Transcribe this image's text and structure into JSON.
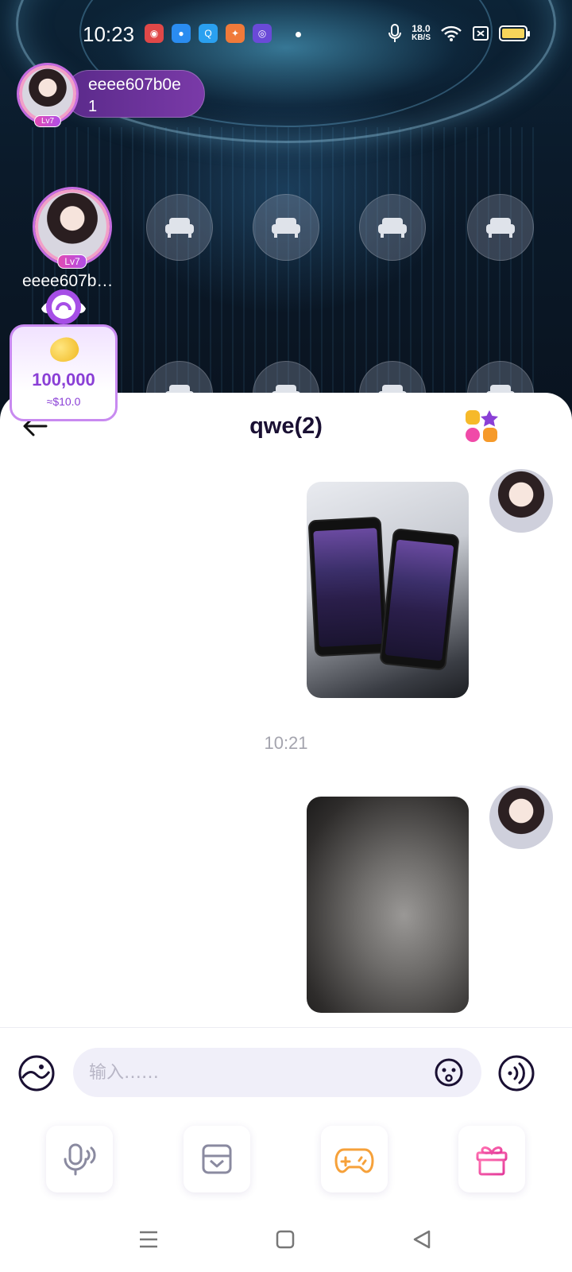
{
  "status_bar": {
    "time": "10:23",
    "speed_value": "18.0",
    "speed_unit": "KB/S",
    "app_icons": [
      "baidu-app-icon",
      "media-app-icon",
      "browser-app-icon",
      "game-app-icon",
      "vpn-app-icon"
    ]
  },
  "room": {
    "host": {
      "name": "eeee607b0e",
      "count": "1",
      "level": "Lv7"
    },
    "seat_user": {
      "name": "eeee607b…",
      "level": "Lv7"
    },
    "coins": {
      "value": "100,000",
      "usd": "≈$10.0"
    }
  },
  "chat": {
    "title": "qwe(2)",
    "timestamp": "10:21",
    "input_placeholder": "输入……"
  },
  "colors": {
    "accent": "#8a3fd6",
    "title": "#1a1033",
    "input_bg": "#f0eff9",
    "game_icon": "#f6a13a",
    "gift_icon": "#f04aa8"
  }
}
